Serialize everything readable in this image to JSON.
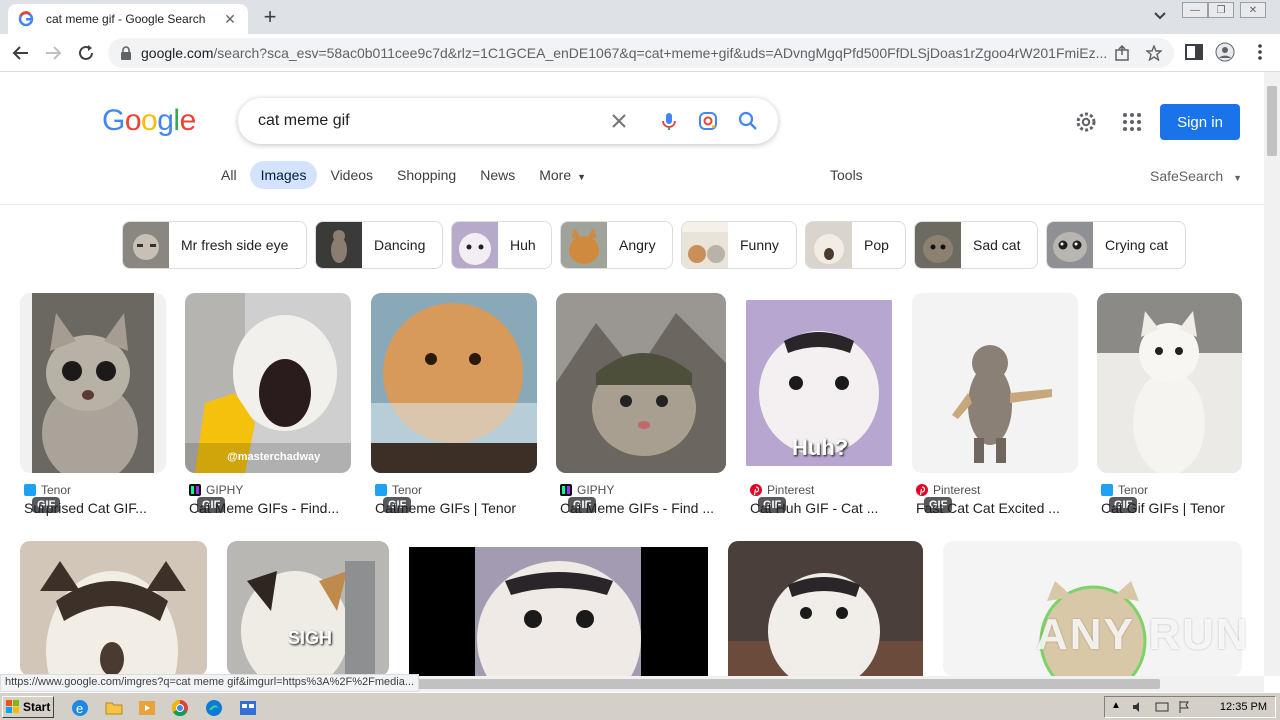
{
  "browser": {
    "tab_title": "cat meme gif - Google Search",
    "url_host": "google.com",
    "url_path": "/search?sca_esv=58ac0b011cee9c7d&rlz=1C1GCEA_enDE1067&q=cat+meme+gif&uds=ADvngMgqPfd500FfDLSjDoas1rZgoo4rW201FmiEz...",
    "status_url": "https://www.google.com/imgres?q=cat meme gif&imgurl=https%3A%2F%2Fmedia..."
  },
  "header": {
    "search_value": "cat meme gif",
    "signin_label": "Sign in"
  },
  "nav": {
    "tabs": [
      "All",
      "Images",
      "Videos",
      "Shopping",
      "News",
      "More"
    ],
    "tools": "Tools",
    "safesearch": "SafeSearch"
  },
  "chips": [
    "Mr fresh side eye",
    "Dancing",
    "Huh",
    "Angry",
    "Funny",
    "Pop",
    "Sad cat",
    "Crying cat"
  ],
  "results": [
    {
      "source": "Tenor",
      "caption": "Surprised Cat GIF...",
      "badge": "GIF"
    },
    {
      "source": "GIPHY",
      "caption": "Cat Meme GIFs - Find...",
      "badge": "GIF",
      "overlay": "@masterchadway"
    },
    {
      "source": "Tenor",
      "caption": "Catmeme GIFs | Tenor",
      "badge": "GIF"
    },
    {
      "source": "GIPHY",
      "caption": "Cat Meme GIFs - Find ...",
      "badge": "GIF"
    },
    {
      "source": "Pinterest",
      "caption": "Cat Huh GIF - Cat ...",
      "badge": "GIF",
      "overlay": "Huh?"
    },
    {
      "source": "Pinterest",
      "caption": "Fast Cat Cat Excited ...",
      "badge": "GIF"
    },
    {
      "source": "Tenor",
      "caption": "Cat Gif GIFs | Tenor",
      "badge": "GIF"
    }
  ],
  "row2": {
    "overlay": "SIGH"
  },
  "watermark": "ANY RUN",
  "taskbar": {
    "start": "Start",
    "clock": "12:35 PM"
  },
  "colors": {
    "accent": "#1a73e8",
    "chip_active": "#d3e3fd"
  }
}
